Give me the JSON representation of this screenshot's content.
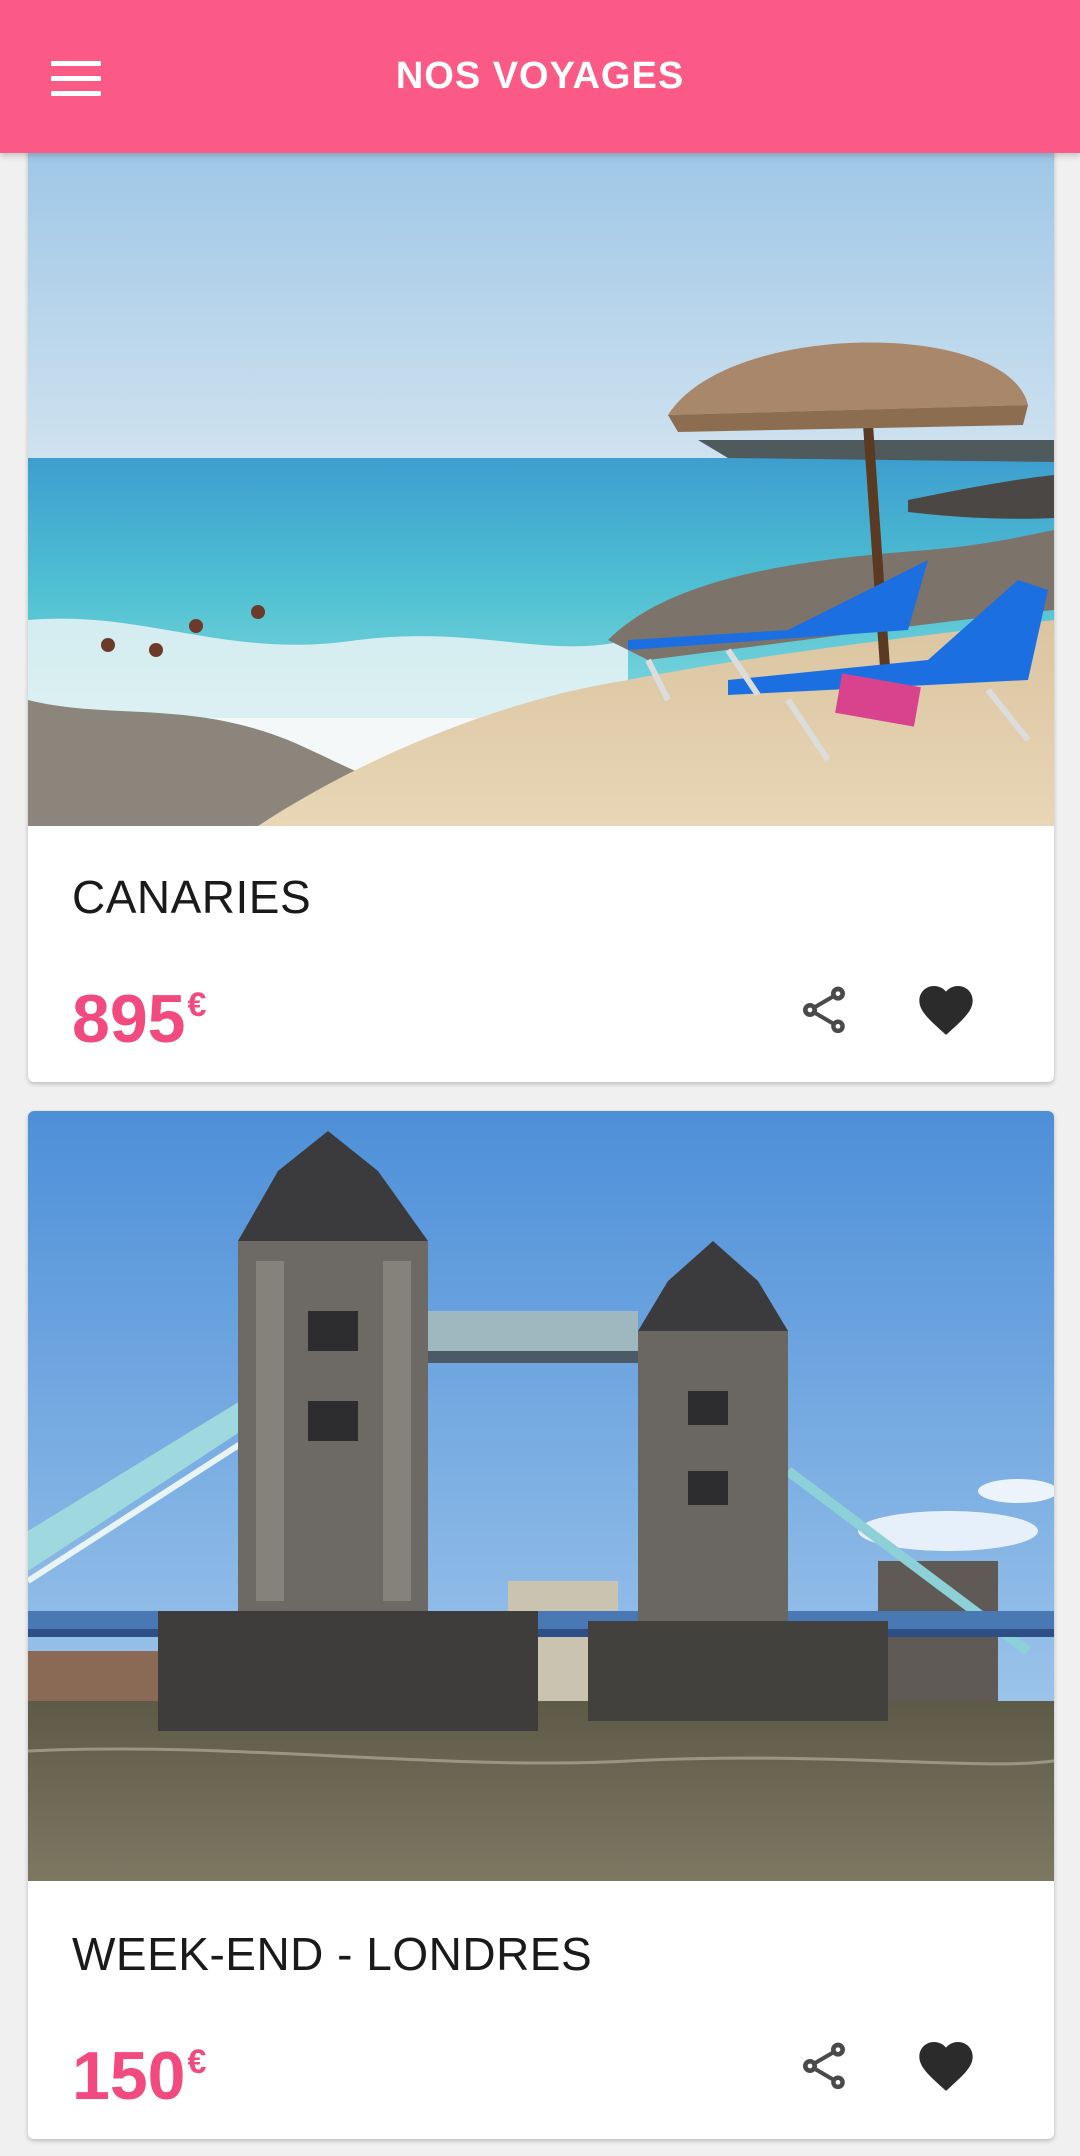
{
  "app_bar": {
    "title": "NOS VOYAGES",
    "menu_icon": "hamburger-menu-icon",
    "color": "#fb5a87"
  },
  "cards": [
    {
      "title": "CANARIES",
      "price": "895",
      "currency": "€",
      "image": "beach-with-parasol-and-sunbeds",
      "share_icon": "share-icon",
      "favorite_icon": "heart-icon"
    },
    {
      "title": "WEEK-END - LONDRES",
      "price": "150",
      "currency": "€",
      "image": "tower-bridge-london",
      "share_icon": "share-icon",
      "favorite_icon": "heart-icon"
    }
  ],
  "colors": {
    "price": "#f24a7f",
    "icon": "#333333"
  }
}
